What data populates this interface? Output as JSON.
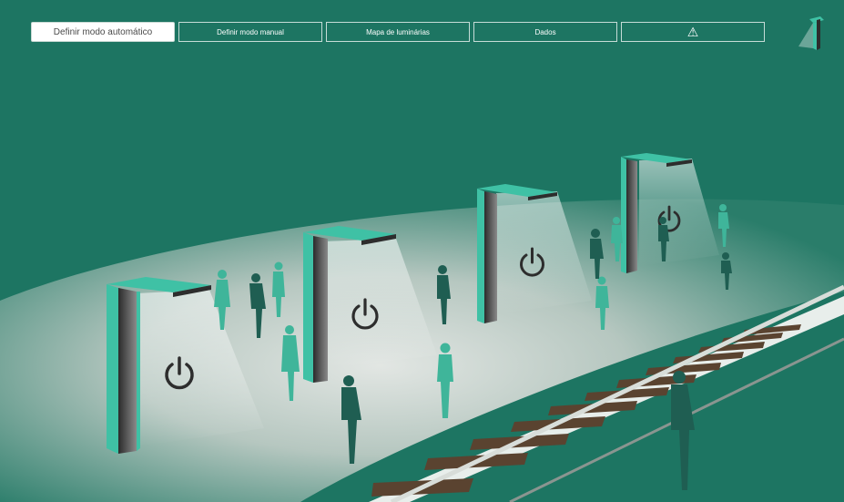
{
  "nav": {
    "auto_label": "Definir modo automático",
    "manual_label": "Definir modo manual",
    "map_label": "Mapa de luminárias",
    "data_label": "Dados",
    "alert_icon": "warning-icon"
  },
  "logo": {
    "icon": "street-lamp-logo-icon"
  },
  "scene": {
    "luminaires": [
      {
        "id": 1,
        "icon": "power-icon"
      },
      {
        "id": 2,
        "icon": "power-icon"
      },
      {
        "id": 3,
        "icon": "power-icon"
      },
      {
        "id": 4,
        "icon": "power-icon"
      }
    ]
  },
  "colors": {
    "background": "#1d7562",
    "accent": "#3fc1a5",
    "platform": "#c9d3ce",
    "rail": "#5a4330"
  }
}
